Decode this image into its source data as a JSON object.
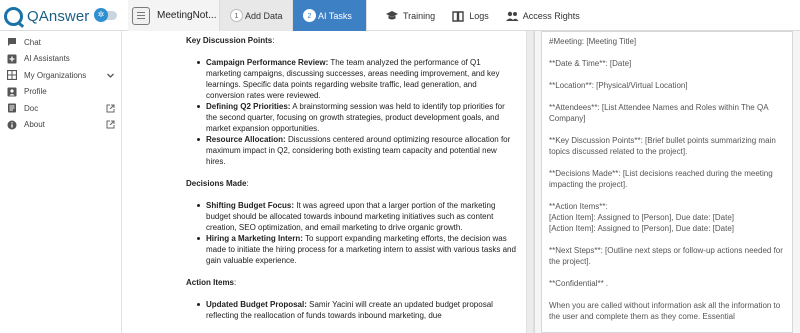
{
  "app": {
    "logo_text": "QAnswer",
    "toggle_glyph": "✲"
  },
  "tabs": {
    "document_label": "MeetingNot...",
    "steps": [
      {
        "num": "1",
        "label": "Add Data"
      },
      {
        "num": "2",
        "label": "AI Tasks"
      }
    ],
    "nav": [
      {
        "label": "Training",
        "icon": "graduation-cap-icon"
      },
      {
        "label": "Logs",
        "icon": "book-icon"
      },
      {
        "label": "Access Rights",
        "icon": "people-icon"
      }
    ]
  },
  "sidebar": {
    "items": [
      {
        "label": "Chat",
        "icon": "chat-icon"
      },
      {
        "label": "AI Assistants",
        "icon": "plus-box-icon"
      },
      {
        "label": "My Organizations",
        "icon": "grid-icon",
        "trail": "chevron-down-icon"
      },
      {
        "label": "Profile",
        "icon": "person-card-icon"
      },
      {
        "label": "Doc",
        "icon": "document-icon",
        "trail": "external-link-icon"
      },
      {
        "label": "About",
        "icon": "info-icon",
        "trail": "external-link-icon"
      }
    ]
  },
  "document": {
    "key_points_heading": "Key Discussion Points",
    "key_points": [
      {
        "title": "Campaign Performance Review:",
        "text": " The team analyzed the performance of Q1 marketing campaigns, discussing successes, areas needing improvement, and key learnings. Specific data points regarding website traffic, lead generation, and conversion rates were reviewed."
      },
      {
        "title": "Defining Q2 Priorities:",
        "text": " A brainstorming session was held to identify top priorities for the second quarter, focusing on growth strategies, product development goals, and market expansion opportunities."
      },
      {
        "title": "Resource Allocation:",
        "text": " Discussions centered around optimizing resource allocation for maximum impact in Q2, considering both existing team capacity and potential new hires."
      }
    ],
    "decisions_heading": "Decisions Made",
    "decisions": [
      {
        "title": "Shifting Budget Focus:",
        "text": " It was agreed upon that a larger portion of the marketing budget should be allocated towards inbound marketing initiatives such as content creation, SEO optimization, and email marketing to drive organic growth."
      },
      {
        "title": "Hiring a Marketing Intern:",
        "text": " To support expanding marketing efforts, the decision was made to initiate the hiring process for a marketing intern to assist with various tasks and gain valuable experience."
      }
    ],
    "actions_heading": "Action Items",
    "actions": [
      {
        "title": "Updated Budget Proposal:",
        "text": " Samir Yacini will create an updated budget proposal reflecting the reallocation of funds towards inbound marketing, due"
      }
    ]
  },
  "prompt": {
    "lines": [
      "#Meeting: [Meeting Title]",
      "",
      "**Date & Time**: [Date]",
      "",
      "**Location**: [Physical/Virtual Location]",
      "",
      "**Attendees**: [List Attendee Names and Roles within The QA Company]",
      "",
      "**Key Discussion Points**: [Brief bullet points summarizing main topics discussed related to the project].",
      "",
      "**Decisions Made**: [List decisions reached during the meeting impacting the project].",
      "",
      "**Action Items**:",
      "[Action Item]: Assigned to [Person], Due date: [Date]",
      "[Action Item]: Assigned to [Person], Due date: [Date]",
      "",
      "**Next Steps**: [Outline next steps or follow-up actions needed for the project].",
      "",
      "**Confidential** .",
      "",
      "When you are called without information ask all the information to the user and complete them as they come. Essential"
    ]
  }
}
